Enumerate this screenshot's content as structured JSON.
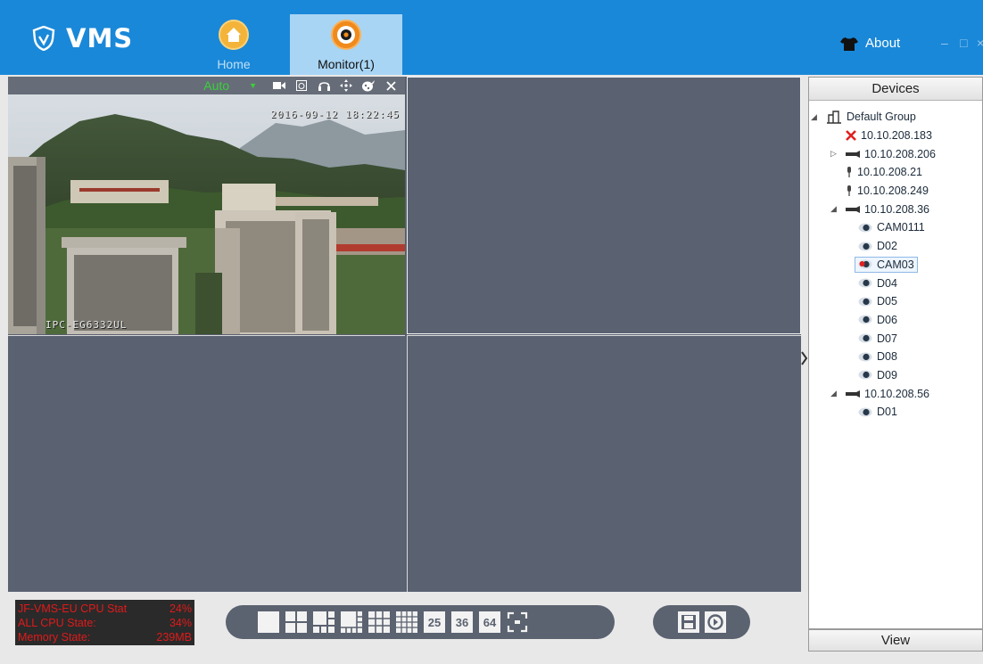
{
  "app": {
    "name": "VMS"
  },
  "tabs": [
    {
      "label": "Home"
    },
    {
      "label": "Monitor(1)"
    }
  ],
  "header": {
    "about_label": "About",
    "minimize": "–",
    "maximize": "□",
    "close": "×"
  },
  "video": {
    "stream_mode": "Auto",
    "osd_time": "2016-09-12 18:22:45",
    "osd_name": "IPC-EG6332UL",
    "toolbar_icons": [
      "record-icon",
      "snapshot-icon",
      "audio-icon",
      "ptz-icon",
      "color-adjust-icon",
      "close-icon"
    ]
  },
  "sidebar": {
    "title": "Devices",
    "footer": "View",
    "tree": [
      {
        "label": "Default Group",
        "type": "group",
        "indent": 0,
        "expanded": true
      },
      {
        "label": "10.10.208.183",
        "type": "offline",
        "indent": 1
      },
      {
        "label": "10.10.208.206",
        "type": "nvr",
        "indent": 1,
        "expanded": false
      },
      {
        "label": "10.10.208.21",
        "type": "ipc",
        "indent": 1
      },
      {
        "label": "10.10.208.249",
        "type": "ipc",
        "indent": 1
      },
      {
        "label": "10.10.208.36",
        "type": "nvr",
        "indent": 1,
        "expanded": true
      },
      {
        "label": "CAM0111",
        "type": "channel",
        "indent": 2
      },
      {
        "label": "D02",
        "type": "channel",
        "indent": 2
      },
      {
        "label": "CAM03",
        "type": "channel-active",
        "indent": 2,
        "selected": true
      },
      {
        "label": "D04",
        "type": "channel",
        "indent": 2
      },
      {
        "label": "D05",
        "type": "channel",
        "indent": 2
      },
      {
        "label": "D06",
        "type": "channel",
        "indent": 2
      },
      {
        "label": "D07",
        "type": "channel",
        "indent": 2
      },
      {
        "label": "D08",
        "type": "channel",
        "indent": 2
      },
      {
        "label": "D09",
        "type": "channel",
        "indent": 2
      },
      {
        "label": "10.10.208.56",
        "type": "nvr",
        "indent": 1,
        "expanded": true
      },
      {
        "label": "D01",
        "type": "channel",
        "indent": 2
      }
    ]
  },
  "status": {
    "cpu_label": "JF-VMS-EU CPU Stat",
    "cpu_value": "24%",
    "all_cpu_label": "ALL CPU State:",
    "all_cpu_value": "34%",
    "memory_label": "Memory State:",
    "memory_value": "239MB"
  },
  "layouts": {
    "labels": [
      "25",
      "36",
      "64"
    ],
    "icons": [
      "layout-1-icon",
      "layout-4-icon",
      "layout-6-icon",
      "layout-8-icon",
      "layout-9-icon",
      "layout-16-icon",
      "fullscreen-icon"
    ]
  },
  "colors": {
    "accent": "#1a88d8",
    "status_text": "#e01a1a",
    "stream_mode": "#3ad13a"
  }
}
